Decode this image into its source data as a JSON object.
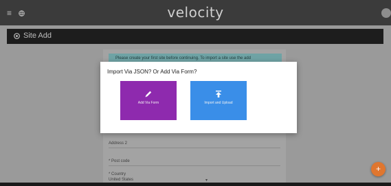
{
  "colors": {
    "topbar": "#3b3b3b",
    "titlebar": "#1d1d1d",
    "form_tile": "#8e2aae",
    "json_tile": "#3a8ee8",
    "fab": "#e0762f",
    "brand_accent": "#d9a34a"
  },
  "topbar": {
    "logo_text": "velocity",
    "icons": [
      "menu-icon",
      "globe-icon",
      "user-icon"
    ]
  },
  "titlebar": {
    "title": "Site Add",
    "icon": "site-icon"
  },
  "form": {
    "banner_text": "Please create your first site before continuing. To import a site use the add",
    "fields": [
      {
        "label": "Address 2"
      },
      {
        "label": "* Post code"
      },
      {
        "label": "* Country"
      }
    ],
    "country_value": "United States"
  },
  "modal": {
    "heading": "Import Via JSON? Or Add Via Form?",
    "add_via_form_label": "Add Via Form",
    "import_upload_label": "Import and Upload",
    "icons": [
      "pencil-icon",
      "upload-icon"
    ]
  },
  "fab": {
    "label": "+"
  }
}
